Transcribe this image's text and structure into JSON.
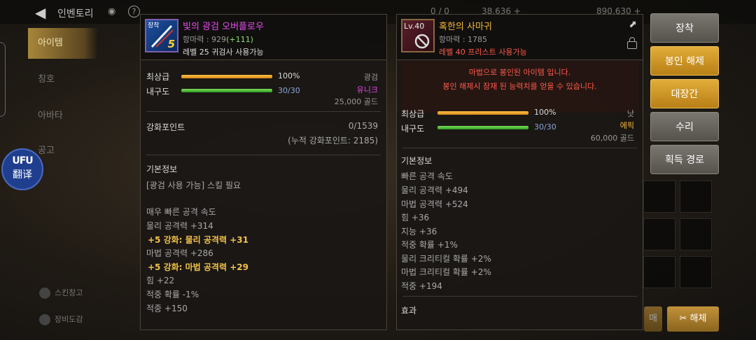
{
  "topbar": {
    "title": "인벤토리",
    "currencies": [
      "0 / 0",
      "38,636 +",
      "890,630 +"
    ]
  },
  "sidebar": {
    "items": [
      {
        "label": "아이템",
        "active": true
      },
      {
        "label": "칭호",
        "active": false
      },
      {
        "label": "아바타",
        "active": false
      },
      {
        "label": "공고",
        "active": false
      }
    ],
    "bottom": [
      {
        "label": "스킨창고"
      },
      {
        "label": "장비도감"
      }
    ]
  },
  "translate_widget": {
    "icon_text": "UFU",
    "label": "翻译"
  },
  "left_item": {
    "badge": "장착",
    "enhance": "5",
    "name": "빛의 광검 오버플로우",
    "name_color": "#e84cf0",
    "power_label": "항마력 : 929",
    "power_bonus": "(+111)",
    "requirement": "레벨 25 귀검사 사용가능",
    "grade_label": "최상급",
    "grade_pct": "100%",
    "grade_fill": 1.0,
    "dura_label": "내구도",
    "dura_value": "30/30",
    "dura_fill": 1.0,
    "type": "광검",
    "rarity": "유니크",
    "rarity_color": "#e84cf0",
    "price": "25,000 골드",
    "enhance_point_label": "강화포인트",
    "enhance_point_value": "0/1539",
    "enhance_point_total": "(누적 강화포인트: 2185)",
    "basic_info_title": "기본정보",
    "skill_req": "[광검 사용 가능] 스킬 필요",
    "stats": [
      {
        "text": "매우 빠른 공격 속도",
        "highlight": false
      },
      {
        "text": "물리 공격력 +314",
        "highlight": false
      },
      {
        "text": "+5 강화: 물리 공격력 +31",
        "highlight": true
      },
      {
        "text": "마법 공격력 +286",
        "highlight": false
      },
      {
        "text": "+5 강화: 마법 공격력 +29",
        "highlight": true
      },
      {
        "text": "힘 +22",
        "highlight": false
      },
      {
        "text": "적중 확률 -1%",
        "highlight": false
      },
      {
        "text": "적중 +150",
        "highlight": false
      }
    ]
  },
  "right_item": {
    "level_badge": "Lv.40",
    "name": "혹한의 사마귀",
    "name_color": "#f2b83a",
    "power_label": "항마력 : 1785",
    "requirement": "레벨 40 프리스트 사용가능",
    "requirement_color": "#ff5a4a",
    "seal_msg1": "마법으로 봉인된 아이템 입니다.",
    "seal_msg2": "봉인 해제시 잠재 된 능력치를 얻을 수 있습니다.",
    "grade_label": "최상급",
    "grade_pct": "100%",
    "grade_fill": 1.0,
    "dura_label": "내구도",
    "dura_value": "30/30",
    "dura_fill": 1.0,
    "type": "낫",
    "rarity": "에픽",
    "rarity_color": "#f2b83a",
    "price": "60,000 골드",
    "basic_info_title": "기본정보",
    "stats": [
      "빠른 공격 속도",
      "물리 공격력 +494",
      "마법 공격력 +524",
      "힘 +36",
      "지능 +36",
      "적중 확률 +1%",
      "물리 크리티컬 확률 +2%",
      "마법 크리티컬 확률 +2%",
      "적중 +194"
    ],
    "effect_title": "효과"
  },
  "actions": {
    "equip": "장착",
    "unseal": "봉인 해제",
    "blacksmith": "대장간",
    "repair": "수리",
    "obtain_path": "획득 경로"
  },
  "bottom_buttons": {
    "sell": "매",
    "dismantle": "해체"
  }
}
